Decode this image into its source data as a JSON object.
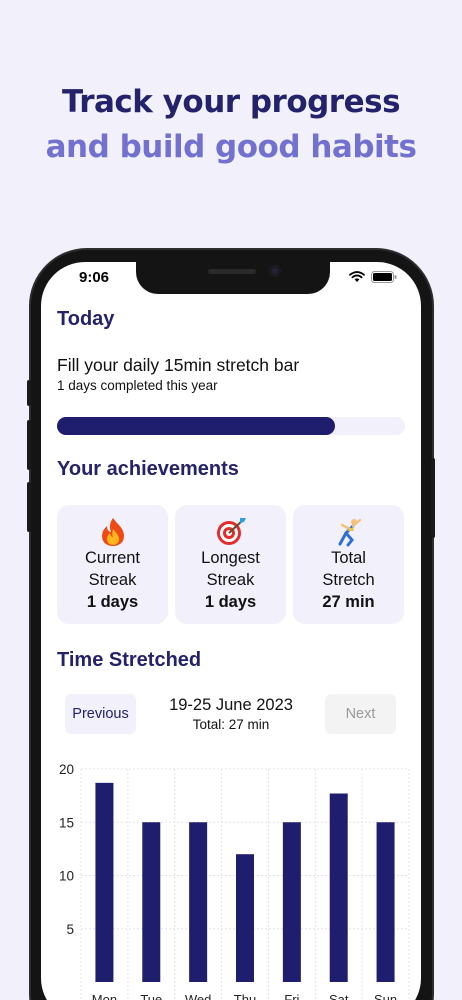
{
  "headline": {
    "line1": "Track your progress",
    "line2": "and build good habits"
  },
  "status_bar": {
    "time": "9:06"
  },
  "today": {
    "title": "Today",
    "fill_title": "Fill your daily 15min stretch bar",
    "fill_subtitle": "1 days completed this year",
    "progress": 0.8
  },
  "achievements": {
    "title": "Your achievements",
    "cards": [
      {
        "icon": "fire-icon",
        "line1": "Current",
        "line2": "Streak",
        "value": "1 days"
      },
      {
        "icon": "target-icon",
        "line1": "Longest",
        "line2": "Streak",
        "value": "1 days"
      },
      {
        "icon": "gymnast-icon",
        "line1": "Total",
        "line2": "Stretch",
        "value": "27 min"
      }
    ]
  },
  "time_stretched": {
    "title": "Time Stretched",
    "previous_label": "Previous",
    "next_label": "Next",
    "range": "19-25 June 2023",
    "total": "Total: 27 min"
  },
  "colors": {
    "accent": "#23226a",
    "accent_light": "#7271cf",
    "bar": "#1f1d6e",
    "card_bg": "#f1f0fb"
  },
  "chart_data": {
    "type": "bar",
    "categories": [
      "Mon",
      "Tue",
      "Wed",
      "Thu",
      "Fri",
      "Sat",
      "Sun"
    ],
    "values": [
      18.7,
      15,
      15,
      12,
      15,
      17.7,
      15
    ],
    "ylim": [
      0,
      20
    ],
    "yticks": [
      5,
      10,
      15,
      20
    ],
    "grid": true
  }
}
